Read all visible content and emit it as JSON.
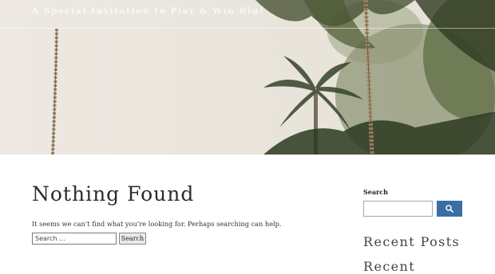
{
  "header": {
    "site_title": "A Special Invitation to Play & Win Big!"
  },
  "main": {
    "title": "Nothing Found",
    "message": "It seems we can’t find what you’re looking for. Perhaps searching can help.",
    "search": {
      "placeholder": "Search …",
      "button_label": "Search"
    }
  },
  "sidebar": {
    "search_widget": {
      "label": "Search",
      "button_icon": "search-icon"
    },
    "widgets": [
      {
        "title": "Recent Posts"
      },
      {
        "title": "Recent"
      }
    ]
  },
  "colors": {
    "accent": "#3a6ea5",
    "text": "#2c2c2c"
  }
}
